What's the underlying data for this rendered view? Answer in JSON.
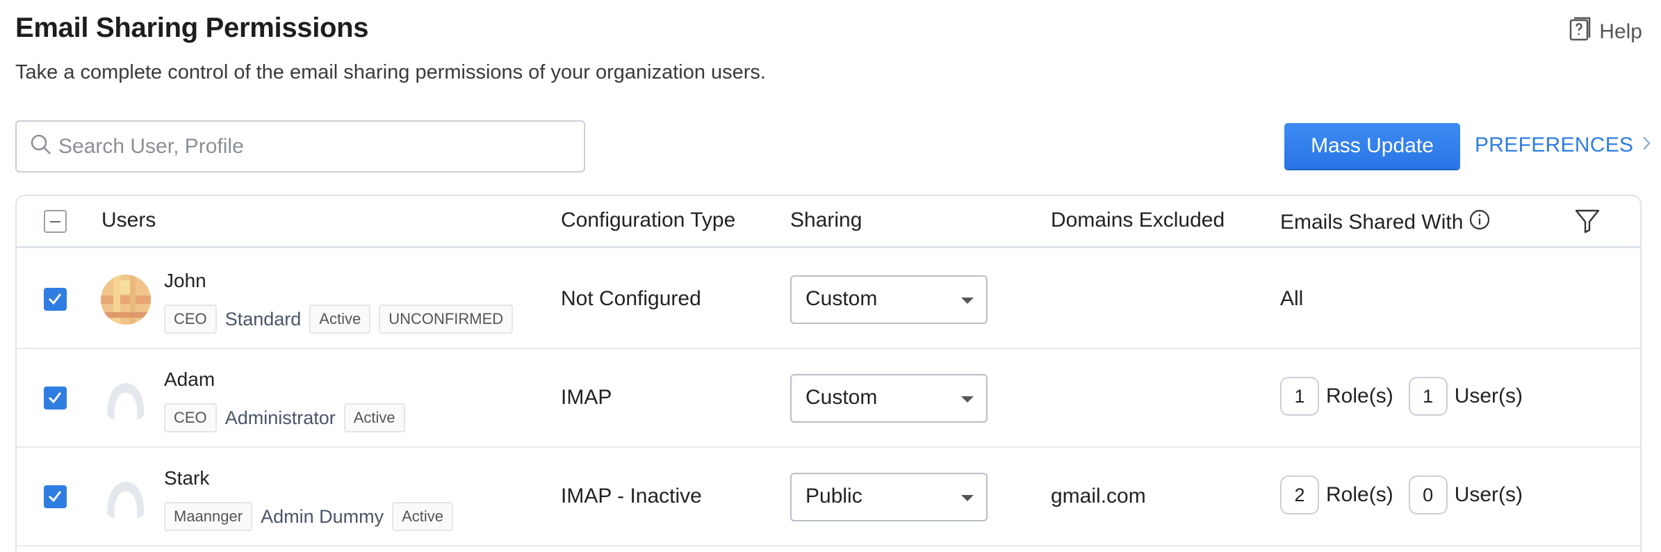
{
  "header": {
    "title": "Email Sharing Permissions",
    "subtitle": "Take a complete control of the email sharing permissions of your organization users.",
    "help_label": "Help"
  },
  "toolbar": {
    "search_placeholder": "Search User, Profile",
    "mass_update_label": "Mass Update",
    "preferences_label": "PREFERENCES"
  },
  "table": {
    "columns": {
      "users": "Users",
      "configuration_type": "Configuration Type",
      "sharing": "Sharing",
      "domains_excluded": "Domains Excluded",
      "emails_shared_with": "Emails Shared With"
    },
    "rows": [
      {
        "name": "John",
        "role": "CEO",
        "profile": "Standard",
        "status": "Active",
        "extra_tag": "UNCONFIRMED",
        "configuration_type": "Not Configured",
        "sharing": "Custom",
        "domains_excluded": "",
        "emails_shared_with": "All",
        "checked": true,
        "avatar": "photo"
      },
      {
        "name": "Adam",
        "role": "CEO",
        "profile": "Administrator",
        "status": "Active",
        "configuration_type": "IMAP",
        "sharing": "Custom",
        "domains_excluded": "",
        "roles_count": "1",
        "roles_label": "Role(s)",
        "users_count": "1",
        "users_label": "User(s)",
        "checked": true,
        "avatar": "placeholder"
      },
      {
        "name": "Stark",
        "role": "Maannger",
        "profile": "Admin Dummy",
        "status": "Active",
        "configuration_type": "IMAP - Inactive",
        "sharing": "Public",
        "domains_excluded": "gmail.com",
        "roles_count": "2",
        "roles_label": "Role(s)",
        "users_count": "0",
        "users_label": "User(s)",
        "checked": true,
        "avatar": "placeholder"
      }
    ]
  },
  "icons": {
    "help": "help-book-icon",
    "search": "search-icon",
    "chevron": "chevron-right-icon",
    "info": "info-icon",
    "filter": "filter-icon",
    "checkbox": "checkmark-icon",
    "dropdown": "caret-down-icon"
  },
  "colors": {
    "accent": "#2f7de1",
    "checkbox": "#2f7de1",
    "text": "#222222",
    "border": "#dfe3e8"
  }
}
